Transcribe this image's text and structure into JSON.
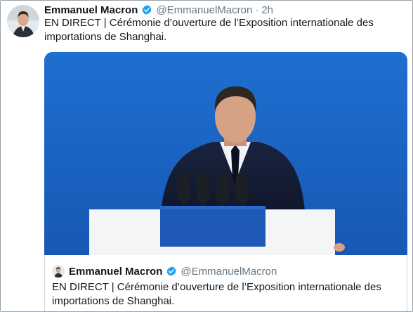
{
  "tweet": {
    "author_name": "Emmanuel Macron",
    "author_handle": "@EmmanuelMacron",
    "separator": "·",
    "time": "2h",
    "verified_icon": "verified-badge-icon",
    "text": "EN DIRECT | Cérémonie d’ouverture de l’Exposition internationale des importations de Shanghai."
  },
  "media": {
    "description_icon": "video-thumbnail",
    "background_color": "#1b67c5"
  },
  "quoted_tweet": {
    "author_name": "Emmanuel Macron",
    "author_handle": "@EmmanuelMacron",
    "text": "EN DIRECT | Cérémonie d’ouverture de l’Exposition internationale des importations de Shanghai."
  },
  "colors": {
    "verified": "#1da1f2",
    "muted": "#657786",
    "text": "#14171a"
  }
}
